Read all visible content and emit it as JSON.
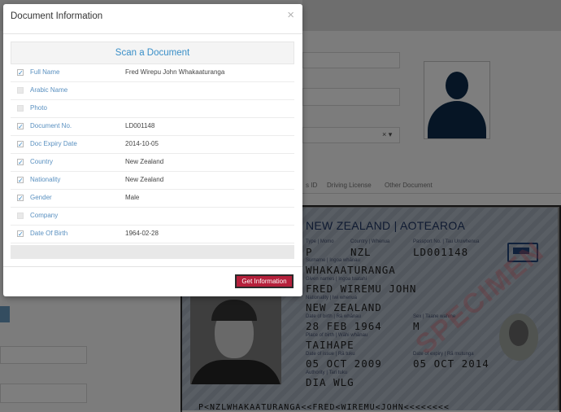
{
  "modal": {
    "title": "Document Information",
    "close_glyph": "×",
    "scan_title": "Scan a Document",
    "get_button": "Get Information",
    "fields": [
      {
        "label": "Full Name",
        "value": "Fred Wirepu John Whakaaturanga",
        "checked": true
      },
      {
        "label": "Arabic Name",
        "value": "",
        "checked": false
      },
      {
        "label": "Photo",
        "value": "",
        "checked": false
      },
      {
        "label": "Document No.",
        "value": "LD001148",
        "checked": true
      },
      {
        "label": "Doc Expiry Date",
        "value": "2014-10-05",
        "checked": true
      },
      {
        "label": "Country",
        "value": "New Zealand",
        "checked": true
      },
      {
        "label": "Nationality",
        "value": "New Zealand",
        "checked": true
      },
      {
        "label": "Gender",
        "value": "Male",
        "checked": true
      },
      {
        "label": "Company",
        "value": "",
        "checked": false
      },
      {
        "label": "Date Of Birth",
        "value": "1964-02-28",
        "checked": true
      }
    ]
  },
  "background": {
    "select_clear_glyph": "× ▾",
    "tabs": [
      "s ID",
      "Driving License",
      "Other Document"
    ]
  },
  "passport": {
    "heading": "NEW ZEALAND | AOTEAROA",
    "type_label": "Type | Momo",
    "country_label": "Country | Whenua",
    "passport_no_label": "Passport No. | Tau Uruwhenua",
    "type": "P",
    "country_code": "NZL",
    "passport_no": "LD001148",
    "surname_label": "Surname | Ingoa whānau",
    "surname": "WHAKAATURANGA",
    "given_label": "Given names | Ingoa tuatahi",
    "given_names": "FRED WIREMU JOHN",
    "nationality_label": "Nationality | Iwi whenua",
    "nationality": "NEW ZEALAND",
    "dob_label": "Date of birth | Rā whānau",
    "dob": "28 FEB 1964",
    "sex_label": "Sex | Taane wahine",
    "sex": "M",
    "pob_label": "Place of birth | Wāhi whānau",
    "pob": "TAIHAPE",
    "issue_label": "Date of issue | Rā tuku",
    "issue_date": "05 OCT 2009",
    "expiry_label": "Date of expiry | Rā mutunga",
    "expiry_date": "05 OCT 2014",
    "authority_label": "Authority | Tari tuku",
    "authority": "DIA WLG",
    "watermark": "SPECIMEN",
    "mrz": "P<NZLWHAKAATURANGA<<FRED<WIREMU<JOHN<<<<<<<<"
  }
}
